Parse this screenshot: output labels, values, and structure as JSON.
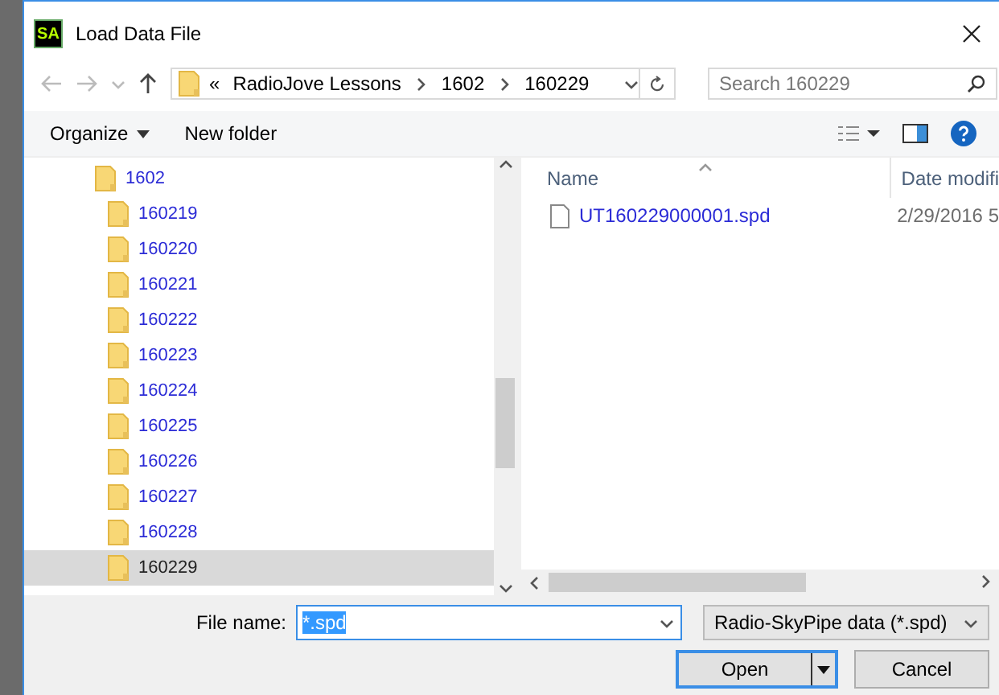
{
  "window": {
    "title": "Load Data File",
    "icon_text": "SA"
  },
  "address": {
    "overflow": "«",
    "crumbs": [
      "RadioJove Lessons",
      "1602",
      "160229"
    ]
  },
  "search": {
    "placeholder": "Search 160229"
  },
  "toolbar": {
    "organize": "Organize",
    "new_folder": "New folder"
  },
  "tree": [
    {
      "label": "1602",
      "selected": false,
      "children": [
        {
          "label": "160219",
          "selected": false
        },
        {
          "label": "160220",
          "selected": false
        },
        {
          "label": "160221",
          "selected": false
        },
        {
          "label": "160222",
          "selected": false
        },
        {
          "label": "160223",
          "selected": false
        },
        {
          "label": "160224",
          "selected": false
        },
        {
          "label": "160225",
          "selected": false
        },
        {
          "label": "160226",
          "selected": false
        },
        {
          "label": "160227",
          "selected": false
        },
        {
          "label": "160228",
          "selected": false
        },
        {
          "label": "160229",
          "selected": true
        }
      ]
    }
  ],
  "columns": [
    "Name",
    "Date modifi"
  ],
  "files": [
    {
      "name": "UT160229000001.spd",
      "date": "2/29/2016 5"
    }
  ],
  "file_name": {
    "label": "File name:",
    "value": "*.spd",
    "text_selected": true
  },
  "file_type": "Radio-SkyPipe data (*.spd)",
  "buttons": [
    {
      "label": "Open",
      "kind": "split",
      "default": true
    },
    {
      "label": "Cancel",
      "kind": "plain",
      "default": false
    }
  ]
}
